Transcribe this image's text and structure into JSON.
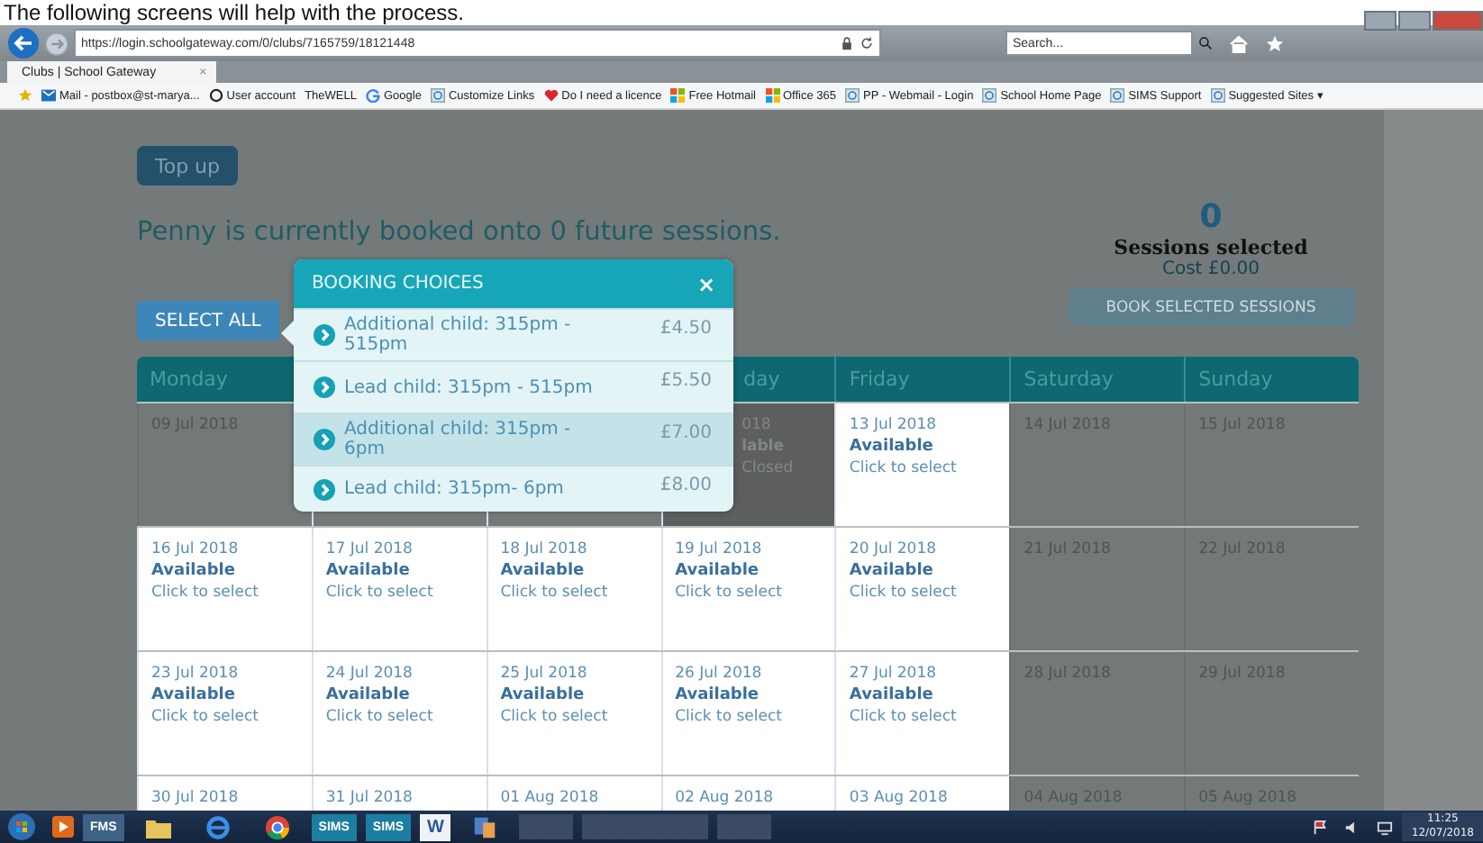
{
  "caption": "The following screens will help with the process.",
  "browser": {
    "url": "https://login.schoolgateway.com/0/clubs/7165759/18121448",
    "search": {
      "placeholder": "Search..."
    },
    "tab": {
      "title": "Clubs | School Gateway",
      "close": "×"
    },
    "favorites": [
      {
        "label": "Mail - postbox@st-marya..."
      },
      {
        "label": "User account"
      },
      {
        "label": "TheWELL"
      },
      {
        "label": "Google"
      },
      {
        "label": "Customize Links"
      },
      {
        "label": "Do I need a licence"
      },
      {
        "label": "Free Hotmail"
      },
      {
        "label": "Office 365"
      },
      {
        "label": "PP - Webmail - Login"
      },
      {
        "label": "School Home Page"
      },
      {
        "label": "SIMS Support"
      },
      {
        "label": "Suggested Sites ▾"
      }
    ]
  },
  "page": {
    "top_up": "Top up",
    "booked_text": "Penny is currently booked onto 0 future sessions.",
    "select_all": "SELECT ALL",
    "summary": {
      "count": "0",
      "label": "Sessions selected",
      "cost": "Cost £0.00",
      "book_button": "BOOK SELECTED SESSIONS",
      "book_disabled": true
    },
    "columns": [
      {
        "kind": "full",
        "label": "Monday"
      },
      {
        "kind": "covered"
      },
      {
        "kind": "covered"
      },
      {
        "kind": "clipped",
        "label": "day"
      },
      {
        "kind": "full",
        "label": "Friday"
      },
      {
        "kind": "full",
        "label": "Saturday"
      },
      {
        "kind": "full",
        "label": "Sunday"
      }
    ],
    "rows": [
      [
        {
          "kind": "past",
          "date": "09 Jul 2018"
        },
        {
          "kind": "covered"
        },
        {
          "kind": "covered"
        },
        {
          "kind": "closed",
          "date": "018",
          "status": "lable",
          "action": "Closed"
        },
        {
          "kind": "available",
          "date": "13 Jul 2018",
          "status": "Available",
          "action": "Click to select"
        },
        {
          "kind": "past",
          "date": "14 Jul 2018"
        },
        {
          "kind": "past",
          "date": "15 Jul 2018"
        }
      ],
      [
        {
          "kind": "available",
          "date": "16 Jul 2018",
          "status": "Available",
          "action": "Click to select"
        },
        {
          "kind": "available",
          "date": "17 Jul 2018",
          "status": "Available",
          "action": "Click to select"
        },
        {
          "kind": "available",
          "date": "18 Jul 2018",
          "status": "Available",
          "action": "Click to select"
        },
        {
          "kind": "available",
          "date": "19 Jul 2018",
          "status": "Available",
          "action": "Click to select"
        },
        {
          "kind": "available",
          "date": "20 Jul 2018",
          "status": "Available",
          "action": "Click to select"
        },
        {
          "kind": "past",
          "date": "21 Jul 2018"
        },
        {
          "kind": "past",
          "date": "22 Jul 2018"
        }
      ],
      [
        {
          "kind": "available",
          "date": "23 Jul 2018",
          "status": "Available",
          "action": "Click to select"
        },
        {
          "kind": "available",
          "date": "24 Jul 2018",
          "status": "Available",
          "action": "Click to select"
        },
        {
          "kind": "available",
          "date": "25 Jul 2018",
          "status": "Available",
          "action": "Click to select"
        },
        {
          "kind": "available",
          "date": "26 Jul 2018",
          "status": "Available",
          "action": "Click to select"
        },
        {
          "kind": "available",
          "date": "27 Jul 2018",
          "status": "Available",
          "action": "Click to select"
        },
        {
          "kind": "past",
          "date": "28 Jul 2018"
        },
        {
          "kind": "past",
          "date": "29 Jul 2018"
        }
      ],
      [
        {
          "kind": "available",
          "date": "30 Jul 2018"
        },
        {
          "kind": "available",
          "date": "31 Jul 2018"
        },
        {
          "kind": "available",
          "date": "01 Aug 2018"
        },
        {
          "kind": "available",
          "date": "02 Aug 2018"
        },
        {
          "kind": "available",
          "date": "03 Aug 2018"
        },
        {
          "kind": "past",
          "date": "04 Aug 2018"
        },
        {
          "kind": "past",
          "date": "05 Aug 2018"
        }
      ]
    ],
    "popup": {
      "title": "BOOKING CHOICES",
      "close": "×",
      "choices": [
        {
          "label": "Additional child: 315pm - 515pm",
          "price": "£4.50",
          "selected": false
        },
        {
          "label": "Lead child: 315pm - 515pm",
          "price": "£5.50",
          "selected": false
        },
        {
          "label": "Additional child: 315pm - 6pm",
          "price": "£7.00",
          "selected": true
        },
        {
          "label": "Lead child: 315pm- 6pm",
          "price": "£8.00",
          "selected": false
        }
      ]
    }
  },
  "taskbar": {
    "apps": [
      {
        "kind": "fms",
        "label": "FMS"
      },
      {
        "kind": "folder"
      },
      {
        "kind": "ie"
      },
      {
        "kind": "chrome"
      },
      {
        "kind": "sims",
        "label": "SIMS"
      },
      {
        "kind": "sims",
        "label": "SIMS"
      },
      {
        "kind": "word",
        "label": "W"
      },
      {
        "kind": "misc"
      }
    ],
    "time": "11:25",
    "date": "12/07/2018"
  }
}
